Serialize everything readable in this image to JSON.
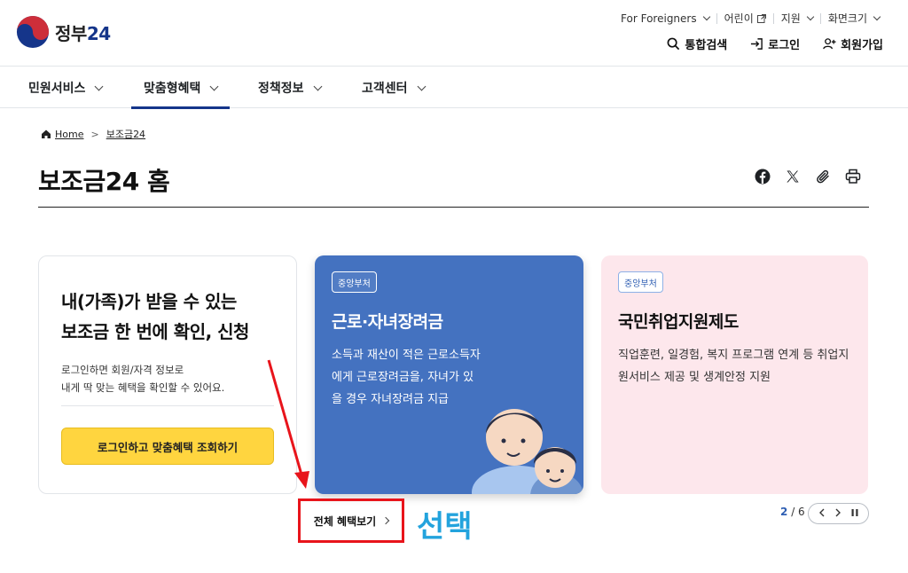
{
  "header": {
    "logo_text": "정부",
    "logo_num": "24",
    "util": {
      "foreigners": "For Foreigners",
      "kids": "어린이",
      "support": "지원",
      "zoom": "화면크기"
    },
    "account": {
      "search": "통합검색",
      "login": "로그인",
      "signup": "회원가입"
    }
  },
  "nav": {
    "items": [
      {
        "label": "민원서비스"
      },
      {
        "label": "맞춤형혜택"
      },
      {
        "label": "정책정보"
      },
      {
        "label": "고객센터"
      }
    ]
  },
  "breadcrumb": {
    "home": "Home",
    "current": "보조금24"
  },
  "page": {
    "title": "보조금24 홈"
  },
  "login_card": {
    "heading_line1": "내(가족)가 받을 수 있는",
    "heading_line2": "보조금 한 번에 확인, 신청",
    "desc_line1": "로그인하면 회원/자격 정보로",
    "desc_line2": "내게 딱 맞는 혜택을 확인할 수 있어요.",
    "button": "로그인하고 맞춤혜택 조회하기"
  },
  "cards": [
    {
      "tag": "중앙부처",
      "title": "근로·자녀장려금",
      "desc": "소득과 재산이 적은 근로소득자에게 근로장려금을, 자녀가 있을 경우 자녀장려금 지급",
      "color": "#4472c0"
    },
    {
      "tag": "중앙부처",
      "title": "국민취업지원제도",
      "desc": "직업훈련, 일경험, 복지 프로그램 연계 등 취업지원서비스 제공 및 생계안정 지원",
      "color": "#fde7ec"
    }
  ],
  "bottom": {
    "view_all": "전체 혜택보기",
    "annotation": "선택",
    "page_current": "2",
    "page_total": "/ 6"
  },
  "colors": {
    "brand_navy": "#15358a",
    "highlight_red": "#e8141b",
    "annotation_blue": "#23a3dd",
    "button_yellow": "#ffd53f"
  }
}
